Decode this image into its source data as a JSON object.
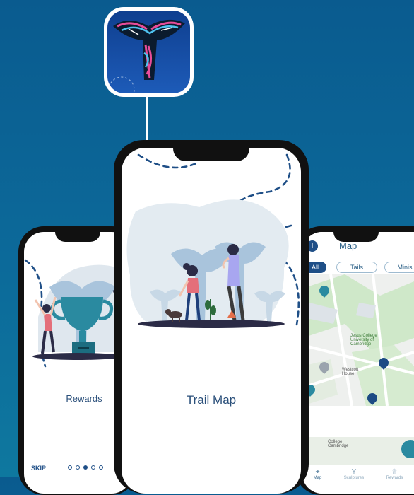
{
  "colors": {
    "background": "#0a5b8f",
    "phone_frame": "#111111",
    "accent_blue": "#1f4f87",
    "teal": "#2a8aa0",
    "map_green": "#cfe8c9"
  },
  "left_phone": {
    "title": "Rewards",
    "skip_label": "SKIP",
    "page_dots": [
      "dot",
      "dot",
      "dot-active",
      "dot",
      "dot"
    ]
  },
  "center_phone": {
    "title": "Trail Map"
  },
  "right_phone": {
    "header_title": "Map",
    "tabs": [
      "All",
      "Tails",
      "Minis"
    ],
    "active_tab": "All",
    "map_labels": {
      "college1": "Jesus College\nUniversity of\nCambridge",
      "house": "Westcott\nHouse",
      "college2": "College\nCambridge"
    },
    "bottom_nav": [
      {
        "label": "Map",
        "icon": "map-pin-icon"
      },
      {
        "label": "Sculptures",
        "icon": "tail-icon"
      },
      {
        "label": "Rewards",
        "icon": "trophy-icon"
      }
    ]
  },
  "icons": [
    "whale-tail-icon",
    "trophy-icon",
    "map-pin-icon"
  ]
}
